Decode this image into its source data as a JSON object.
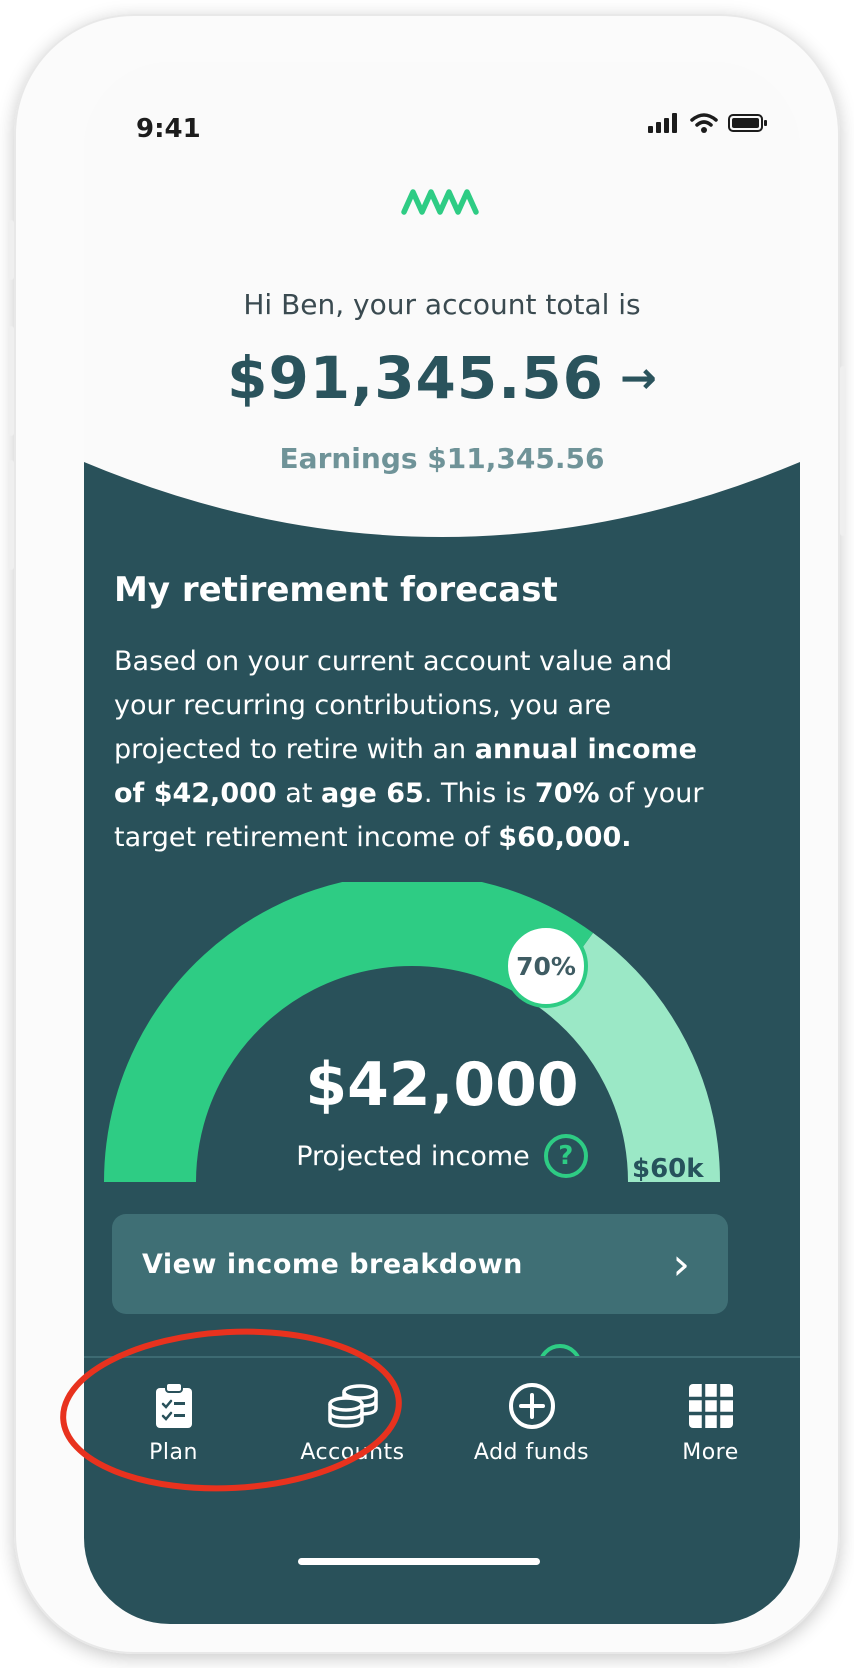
{
  "status_bar": {
    "time": "9:41"
  },
  "header": {
    "greeting": "Hi Ben, your account total is",
    "account_total": "$91,345.56",
    "total_arrow": "→",
    "earnings": "Earnings $11,345.56"
  },
  "forecast": {
    "title": "My retirement forecast",
    "body_1": "Based on your current account value and your recurring contributions, you are projected to retire with an ",
    "body_bold_1": "annual income of $42,000",
    "body_2": " at ",
    "body_bold_2": "age 65",
    "body_3": ". This is ",
    "body_bold_3": "70%",
    "body_4": " of your target retirement income of ",
    "body_bold_4": "$60,000."
  },
  "gauge": {
    "projected_amount": "$42,000",
    "label": "Projected income",
    "help_glyph": "?",
    "percent_label": "70%",
    "percent_value": 0.7,
    "max_label": "$60k",
    "colors": {
      "progress": "#2ecc84",
      "remaining": "#9be8c6"
    }
  },
  "breakdown_button": {
    "label": "View income breakdown",
    "chevron": "›"
  },
  "tabs": [
    {
      "label": "Plan",
      "icon": "clipboard-check-icon"
    },
    {
      "label": "Accounts",
      "icon": "coins-stack-icon"
    },
    {
      "label": "Add funds",
      "icon": "plus-circle-icon"
    },
    {
      "label": "More",
      "icon": "grid-icon"
    }
  ],
  "colors": {
    "panel": "#29515a",
    "accent": "#2ecc84",
    "annotation": "#e8321e"
  }
}
